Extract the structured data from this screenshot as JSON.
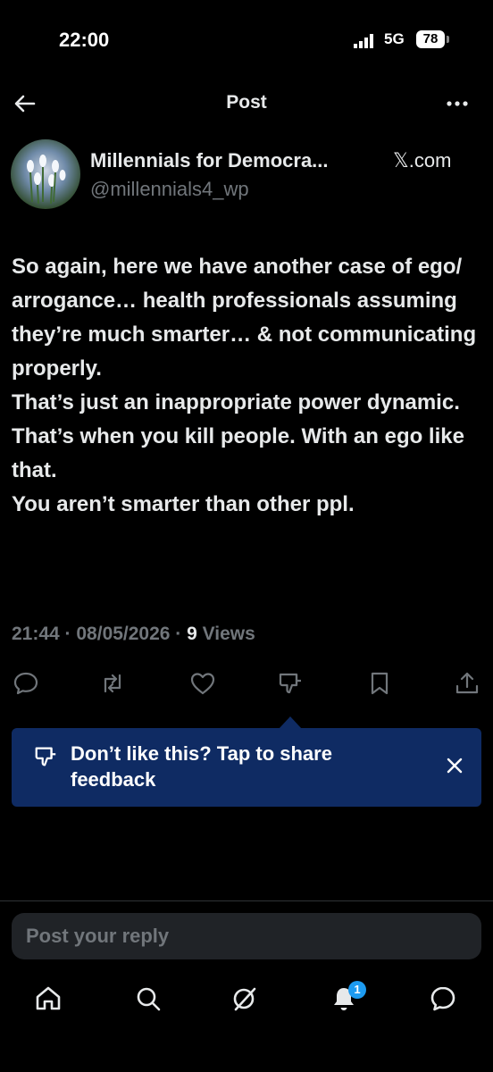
{
  "status_bar": {
    "time": "22:00",
    "network": "5G",
    "battery": "78"
  },
  "header": {
    "title": "Post"
  },
  "post": {
    "author_name": "Millennials for Democra...",
    "source": "𝕏.com",
    "handle": "@millennials4_wp",
    "paragraphs": [
      "So again, here we have another case of ego/ arrogance… health professionals assuming they’re much smarter… & not communicating properly.",
      "That’s just an inappropriate power dynamic.",
      "That’s when you kill people. With an ego like that.",
      "You aren’t smarter than other ppl."
    ],
    "timestamp": "21:44 · 08/05/2026 · ",
    "views_count": "9",
    "views_label": " Views"
  },
  "actions": [
    "reply-icon",
    "repost-icon",
    "like-icon",
    "dislike-icon",
    "bookmark-icon",
    "share-icon"
  ],
  "feedback": {
    "text": "Don’t like this? Tap to share feedback"
  },
  "reply": {
    "placeholder": "Post your reply"
  },
  "bottom_nav": {
    "items": [
      "home-icon",
      "search-icon",
      "grok-icon",
      "notifications-icon",
      "messages-icon"
    ],
    "notification_badge": "1"
  },
  "colors": {
    "background": "#000000",
    "text": "#e7e9ea",
    "muted": "#71767b",
    "accent": "#1d9bf0",
    "feedback_bg": "#0f2b63"
  }
}
